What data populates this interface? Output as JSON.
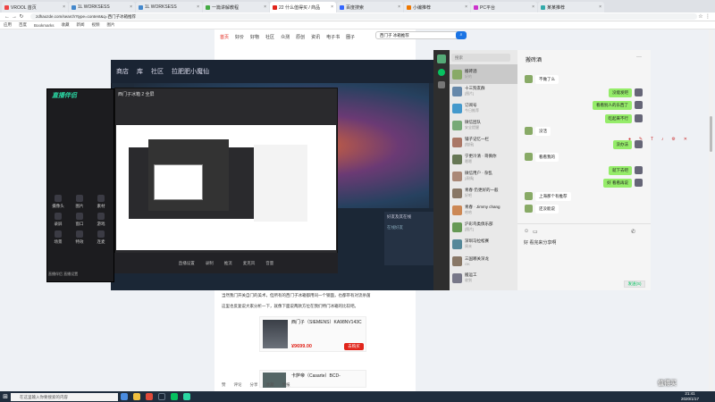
{
  "browser": {
    "tabs": [
      {
        "label": "VROOL 首页",
        "color": "#e44"
      },
      {
        "label": "1L WORKSESS",
        "color": "#48c"
      },
      {
        "label": "1L WORKSESS",
        "color": "#48c"
      },
      {
        "label": "一篇讲解教程",
        "color": "#4a4"
      },
      {
        "label": "22 什么值得买 / 商品",
        "color": "#e1251b"
      },
      {
        "label": "百度搜索",
        "color": "#36f"
      },
      {
        "label": "小编推荐",
        "color": "#e70"
      },
      {
        "label": "PC平台",
        "color": "#c3c"
      },
      {
        "label": "某某推荐",
        "color": "#3aa"
      }
    ],
    "url": "zdhaozde.com/search?type=content&q=西门子冰箱推荐",
    "bookmarks": [
      "应用",
      "百度",
      "Bookmarks",
      "收藏",
      "新闻",
      "视频",
      "图片"
    ]
  },
  "site": {
    "nav": [
      "首页",
      "好价",
      "好物",
      "社区",
      "众测",
      "原创",
      "资讯",
      "电子书",
      "圈子"
    ],
    "search_value": "西门子 冰箱推荐",
    "article_lines": [
      "当然我门开关自门的美术，但所有的西门子冰箱都用同一个钢面，也都带有对流杀菌",
      "这里也反复说大家分析一下，就像下面说两款方位在我们特门冰箱的比较吧。"
    ],
    "product": {
      "name": "西门子（SIEMENS）KA98NV143C",
      "price": "¥9699.00",
      "buy": "去购买"
    },
    "product2": {
      "name": "卡萨帝（Casarte）BCD-"
    },
    "bottom_actions": [
      "赞",
      "评论",
      "分享",
      "收藏",
      "举报"
    ]
  },
  "game": {
    "nav": [
      "商店",
      "库",
      "社区",
      "拉肥肥小魔仙"
    ],
    "friends_panel": [
      "好友及其在线",
      "在线好友"
    ]
  },
  "streamer": {
    "logo": "直播伴侣",
    "grid": [
      "摄像头",
      "图片",
      "素材",
      "录屏",
      "窗口",
      "游戏",
      "场景",
      "特效",
      "连麦"
    ],
    "footer": "直播伴侣 直播设置"
  },
  "preview": {
    "title": "西门子冰箱 2 全屏",
    "toolbar": [
      "直播设置",
      "录制",
      "推流",
      "麦克风",
      "音量"
    ]
  },
  "wechat": {
    "search_placeholder": "搜索",
    "chat_title": "搬砖酒",
    "contacts": [
      {
        "name": "搬砖酒",
        "msg": "好的",
        "color": "#8a6"
      },
      {
        "name": "十三狗友群",
        "msg": "[图片]",
        "color": "#68a"
      },
      {
        "name": "订阅号",
        "msg": "今日推荐",
        "color": "#49c"
      },
      {
        "name": "微信团队",
        "msg": "安全提醒",
        "color": "#7a7"
      },
      {
        "name": "铺子记忆一栏",
        "msg": "[链接]",
        "color": "#a76"
      },
      {
        "name": "宁更冷清 · 哥俩你",
        "msg": "嗯嗯",
        "color": "#675"
      },
      {
        "name": "微信用户 · 杂乱",
        "msg": "[表情]",
        "color": "#a87"
      },
      {
        "name": "青春·仍更好的一般",
        "msg": "好吧",
        "color": "#876"
      },
      {
        "name": "青春 · Jimmy chang",
        "msg": "哈哈",
        "color": "#c85"
      },
      {
        "name": "沪彩鸟类俱乐部",
        "msg": "[图片]",
        "color": "#695"
      },
      {
        "name": "深圳马拉松赛",
        "msg": "周末",
        "color": "#589"
      },
      {
        "name": "三国哪关深龙",
        "msg": "OK",
        "color": "#876"
      },
      {
        "name": "搬运工",
        "msg": "收到",
        "color": "#778"
      }
    ],
    "messages": [
      {
        "side": "in",
        "text": "不做了么"
      },
      {
        "side": "out",
        "text": "没能发吧"
      },
      {
        "side": "out",
        "text": "看看别人的东西了"
      },
      {
        "side": "out",
        "text": "吃起来不行"
      },
      {
        "side": "in",
        "text": "没活"
      },
      {
        "side": "out",
        "text": "没办法"
      },
      {
        "side": "in",
        "text": "看看我的"
      },
      {
        "side": "out",
        "text": "就下去吧"
      },
      {
        "side": "out",
        "text": "好 看看再说"
      },
      {
        "side": "in",
        "text": "上海那个有推荐"
      },
      {
        "side": "in",
        "text": "还没能说"
      }
    ],
    "input_value": "好 看完来分享啊",
    "send": "发送(S)"
  },
  "taskbar": {
    "search_placeholder": "在这里输入你要搜索的内容",
    "time": "21:41",
    "date": "2020/1/17"
  },
  "watermark": "值得买"
}
